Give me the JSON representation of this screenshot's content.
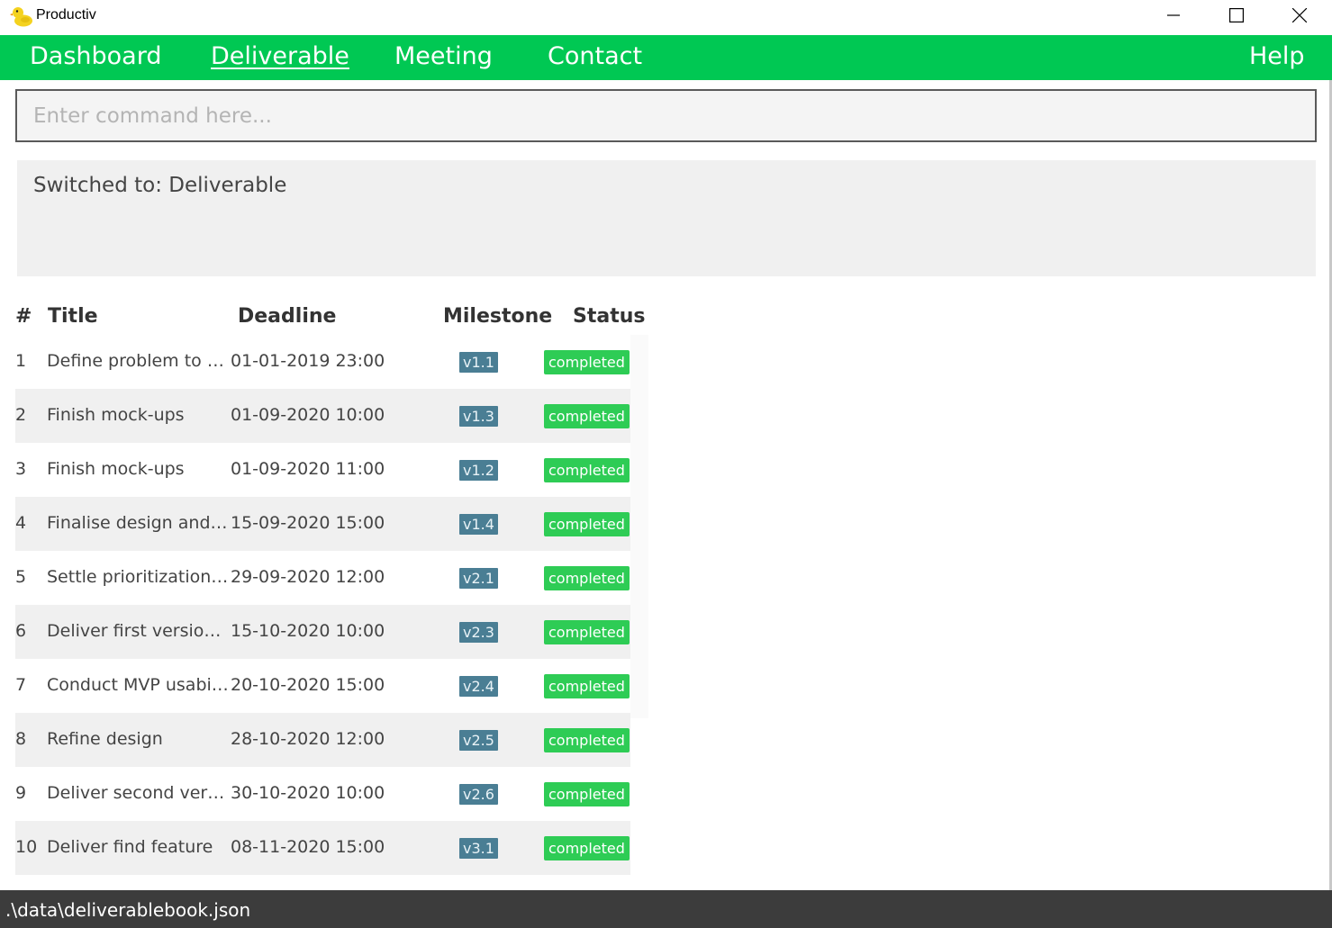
{
  "window": {
    "title": "Productiv",
    "icon": "rubber-duck-icon"
  },
  "menu": {
    "items": [
      {
        "label": "Dashboard"
      },
      {
        "label": "Deliverable"
      },
      {
        "label": "Meeting"
      },
      {
        "label": "Contact"
      }
    ],
    "active": "Deliverable",
    "help": "Help"
  },
  "command": {
    "placeholder": "Enter command here...",
    "value": ""
  },
  "result": {
    "text": "Switched to: Deliverable"
  },
  "table": {
    "headers": {
      "num": "#",
      "title": "Title",
      "deadline": "Deadline",
      "milestone": "Milestone",
      "status": "Status"
    },
    "rows": [
      {
        "num": "1",
        "title": "Define problem to sol...",
        "deadline": "01-01-2019 23:00",
        "milestone": "v1.1",
        "status": "completed"
      },
      {
        "num": "2",
        "title": "Finish mock-ups",
        "deadline": "01-09-2020 10:00",
        "milestone": "v1.3",
        "status": "completed"
      },
      {
        "num": "3",
        "title": "Finish mock-ups",
        "deadline": "01-09-2020 11:00",
        "milestone": "v1.2",
        "status": "completed"
      },
      {
        "num": "4",
        "title": "Finalise design and pl...",
        "deadline": "15-09-2020 15:00",
        "milestone": "v1.4",
        "status": "completed"
      },
      {
        "num": "5",
        "title": "Settle prioritization of...",
        "deadline": "29-09-2020 12:00",
        "milestone": "v2.1",
        "status": "completed"
      },
      {
        "num": "6",
        "title": "Deliver first version of...",
        "deadline": "15-10-2020 10:00",
        "milestone": "v2.3",
        "status": "completed"
      },
      {
        "num": "7",
        "title": "Conduct MVP usabilit...",
        "deadline": "20-10-2020 15:00",
        "milestone": "v2.4",
        "status": "completed"
      },
      {
        "num": "8",
        "title": "Refine design",
        "deadline": "28-10-2020 12:00",
        "milestone": "v2.5",
        "status": "completed"
      },
      {
        "num": "9",
        "title": "Deliver second versio...",
        "deadline": "30-10-2020 10:00",
        "milestone": "v2.6",
        "status": "completed"
      },
      {
        "num": "10",
        "title": "Deliver find feature",
        "deadline": "08-11-2020 15:00",
        "milestone": "v3.1",
        "status": "completed"
      }
    ]
  },
  "statusbar": {
    "path": ".\\data\\deliverablebook.json"
  },
  "colors": {
    "menu_bg": "#00c853",
    "milestone_bg": "#4a7e94",
    "status_bg": "#2ecc55",
    "statusbar_bg": "#3c3c3c"
  }
}
